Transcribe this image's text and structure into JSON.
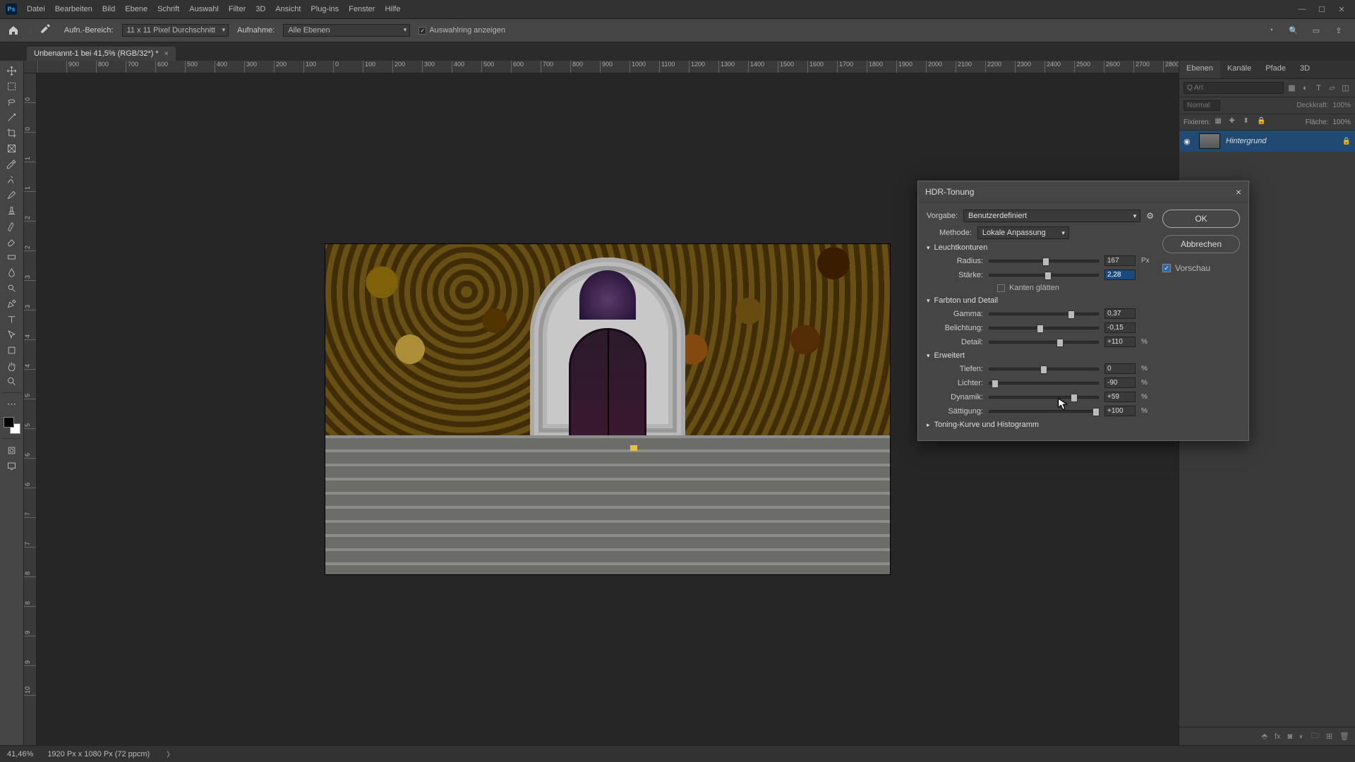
{
  "menu": [
    "Datei",
    "Bearbeiten",
    "Bild",
    "Ebene",
    "Schrift",
    "Auswahl",
    "Filter",
    "3D",
    "Ansicht",
    "Plug-ins",
    "Fenster",
    "Hilfe"
  ],
  "optionsbar": {
    "sample_label": "Aufn.-Bereich:",
    "sample_value": "11 x 11 Pixel Durchschnitt",
    "sample2_label": "Aufnahme:",
    "sample2_value": "Alle Ebenen",
    "show_ring_label": "Auswahlring anzeigen"
  },
  "doc_tab": {
    "title": "Unbenannt-1 bei 41,5% (RGB/32*) *"
  },
  "ruler_h": [
    "",
    "900",
    "800",
    "700",
    "600",
    "500",
    "400",
    "300",
    "200",
    "100",
    "0",
    "100",
    "200",
    "300",
    "400",
    "500",
    "600",
    "700",
    "800",
    "900",
    "1000",
    "1100",
    "1200",
    "1300",
    "1400",
    "1500",
    "1600",
    "1700",
    "1800",
    "1900",
    "2000",
    "2100",
    "2200",
    "2300",
    "2400",
    "2500",
    "2600",
    "2700",
    "2800"
  ],
  "ruler_v": [
    "0",
    "0",
    "1",
    "1",
    "2",
    "2",
    "3",
    "3",
    "4",
    "4",
    "5",
    "5",
    "6",
    "6",
    "7",
    "7",
    "8",
    "8",
    "9",
    "9",
    "10"
  ],
  "panels": {
    "tabs": [
      "Ebenen",
      "Kanäle",
      "Pfade",
      "3D"
    ],
    "search_placeholder": "Q Art",
    "blend_mode": "Normal",
    "opacity_label": "Deckkraft:",
    "opacity_value": "100%",
    "lock_label": "Fixieren:",
    "fill_label": "Fläche:",
    "fill_value": "100%",
    "layer_name": "Hintergrund"
  },
  "dialog": {
    "title": "HDR-Tonung",
    "preset_label": "Vorgabe:",
    "preset_value": "Benutzerdefiniert",
    "method_label": "Methode:",
    "method_value": "Lokale Anpassung",
    "ok": "OK",
    "cancel": "Abbrechen",
    "preview": "Vorschau",
    "sec_edgeglow": "Leuchtkonturen",
    "radius_label": "Radius:",
    "radius_value": "167",
    "radius_unit": "Px",
    "strength_label": "Stärke:",
    "strength_value": "2,28",
    "smooth_edges": "Kanten glätten",
    "sec_tone": "Farbton und Detail",
    "gamma_label": "Gamma:",
    "gamma_value": "0,37",
    "exposure_label": "Belichtung:",
    "exposure_value": "-0,15",
    "detail_label": "Detail:",
    "detail_value": "+110",
    "pct": "%",
    "sec_adv": "Erweitert",
    "shadow_label": "Tiefen:",
    "shadow_value": "0",
    "highlight_label": "Lichter:",
    "highlight_value": "-90",
    "vibrance_label": "Dynamik:",
    "vibrance_value": "+59",
    "saturation_label": "Sättigung:",
    "saturation_value": "+100",
    "sec_curve": "Toning-Kurve und Histogramm"
  },
  "status": {
    "zoom": "41,46%",
    "docinfo": "1920 Px x 1080 Px (72 ppcm)"
  }
}
